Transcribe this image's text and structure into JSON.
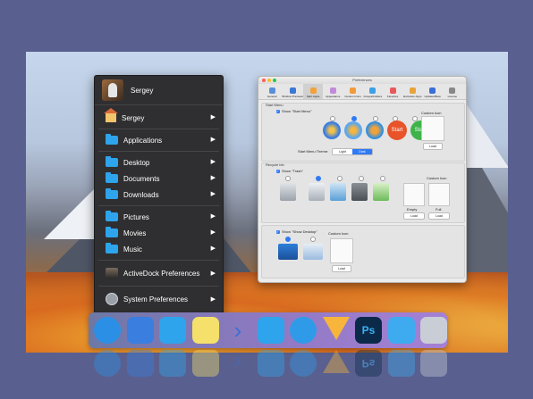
{
  "start_menu": {
    "user": "Sergey",
    "items": [
      {
        "label": "Sergey",
        "icon": "home-icon"
      },
      {
        "label": "Applications",
        "icon": "folder-icon"
      },
      {
        "label": "Desktop",
        "icon": "folder-icon"
      },
      {
        "label": "Documents",
        "icon": "folder-icon"
      },
      {
        "label": "Downloads",
        "icon": "folder-icon"
      },
      {
        "label": "Pictures",
        "icon": "folder-icon"
      },
      {
        "label": "Movies",
        "icon": "folder-icon"
      },
      {
        "label": "Music",
        "icon": "folder-icon"
      },
      {
        "label": "ActiveDock Preferences",
        "icon": "app-icon"
      },
      {
        "label": "System Preferences",
        "icon": "gear-icon"
      }
    ],
    "arrow": "▶"
  },
  "prefs": {
    "title": "Preferences",
    "toolbar": [
      {
        "label": "General",
        "color": "#5a8fd8"
      },
      {
        "label": "Window Previews",
        "color": "#3a78d6"
      },
      {
        "label": "Start Apple",
        "color": "#f2a23a"
      },
      {
        "label": "Appearance",
        "color": "#c28ad8"
      },
      {
        "label": "Custom Icons",
        "color": "#f29a3a"
      },
      {
        "label": "Groups/Folders",
        "color": "#3ba0e8"
      },
      {
        "label": "Favorites",
        "color": "#e85a5a"
      },
      {
        "label": "Exclusion Apps",
        "color": "#e8a33a"
      },
      {
        "label": "Updates/Beta",
        "color": "#3a6fd8"
      },
      {
        "label": "License",
        "color": "#888888"
      }
    ],
    "start_menu_group": {
      "label": "Start Menu",
      "checkbox": "Show \"Start Menu\"",
      "custom_icon": "Custom Icon",
      "load": "Load",
      "theme_label": "Start Menu Theme:",
      "theme_options": [
        "Light",
        "Dark"
      ],
      "theme_selected": "Dark",
      "start_text": "Start"
    },
    "recycle_group": {
      "label": "Recycle bin",
      "checkbox": "Show \"Trash\"",
      "custom_icon": "Custom Icon",
      "empty": "Empty",
      "full": "Full",
      "load": "Load"
    },
    "desktop_group": {
      "checkbox": "Show \"Show Desktop\"",
      "custom_icon": "Custom Icon",
      "load": "Load"
    }
  },
  "dock": {
    "items": [
      {
        "name": "rocket-icon",
        "color": "#2b8fe6"
      },
      {
        "name": "screen-icon",
        "color": "#3a7ee0"
      },
      {
        "name": "finder-icon",
        "color": "#2ea4ec"
      },
      {
        "name": "stickies-icon",
        "color": "#f4e06a"
      },
      {
        "name": "chevron-icon",
        "color": "#3b6fd0"
      },
      {
        "name": "folder-icon",
        "color": "#2ea4ec"
      },
      {
        "name": "safari-icon",
        "color": "#2f9be8"
      },
      {
        "name": "sketch-icon",
        "color": "#f7b53b"
      },
      {
        "name": "photoshop-icon",
        "color": "#0b2a4a"
      },
      {
        "name": "folder-icon",
        "color": "#3eaaf0"
      },
      {
        "name": "trash-icon",
        "color": "#c9ced6"
      }
    ],
    "photoshop_text": "Ps"
  }
}
